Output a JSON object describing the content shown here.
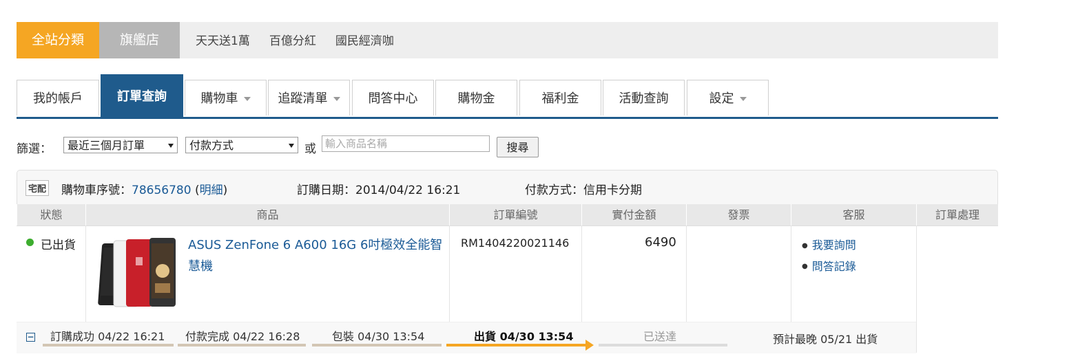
{
  "topbar": {
    "all_categories": "全站分類",
    "flagship": "旗艦店",
    "links": [
      "天天送1萬",
      "百億分紅",
      "國民經濟咖"
    ]
  },
  "tabs": [
    {
      "label": "我的帳戶",
      "active": false,
      "dropdown": false
    },
    {
      "label": "訂單查詢",
      "active": true,
      "dropdown": false
    },
    {
      "label": "購物車",
      "active": false,
      "dropdown": true
    },
    {
      "label": "追蹤清單",
      "active": false,
      "dropdown": true
    },
    {
      "label": "問答中心",
      "active": false,
      "dropdown": false
    },
    {
      "label": "購物金",
      "active": false,
      "dropdown": false
    },
    {
      "label": "福利金",
      "active": false,
      "dropdown": false
    },
    {
      "label": "活動查詢",
      "active": false,
      "dropdown": false
    },
    {
      "label": "設定",
      "active": false,
      "dropdown": true
    }
  ],
  "filter": {
    "label": "篩選：",
    "period_selected": "最近三個月訂單",
    "payment_selected": "付款方式",
    "or": "或",
    "search_placeholder": "輸入商品名稱",
    "search_button": "搜尋"
  },
  "order": {
    "badge": "宅配",
    "cart_label": "購物車序號：",
    "cart_number": "78656780",
    "detail_open": "(",
    "detail_link": "明細",
    "detail_close": ")",
    "order_date": "訂購日期：2014/04/22 16:21",
    "payment": "付款方式：信用卡分期",
    "columns": [
      "狀態",
      "商品",
      "訂單編號",
      "實付金額",
      "發票",
      "客服",
      "訂單處理"
    ],
    "status": "已出貨",
    "product_name": "ASUS ZenFone 6 A600 16G 6吋極效全能智慧機",
    "order_number": "RM1404220021146",
    "amount": "6490",
    "invoice": "",
    "customer_service": [
      "我要詢問",
      "問答記錄"
    ],
    "expander": "⊟",
    "progress": [
      {
        "label": "訂購成功 04/22 16:21",
        "state": "done"
      },
      {
        "label": "付款完成 04/22 16:28",
        "state": "done"
      },
      {
        "label": "包裝 04/30 13:54",
        "state": "done"
      },
      {
        "label": "出貨 04/30 13:54",
        "state": "current"
      },
      {
        "label": "已送達",
        "state": "pending"
      }
    ],
    "estimate": "預計最晚 05/21 出貨"
  },
  "colors": {
    "accent_orange": "#f5a623",
    "tab_active": "#1f5b8c",
    "link": "#1a5a96",
    "status_green": "#3dad2f"
  }
}
